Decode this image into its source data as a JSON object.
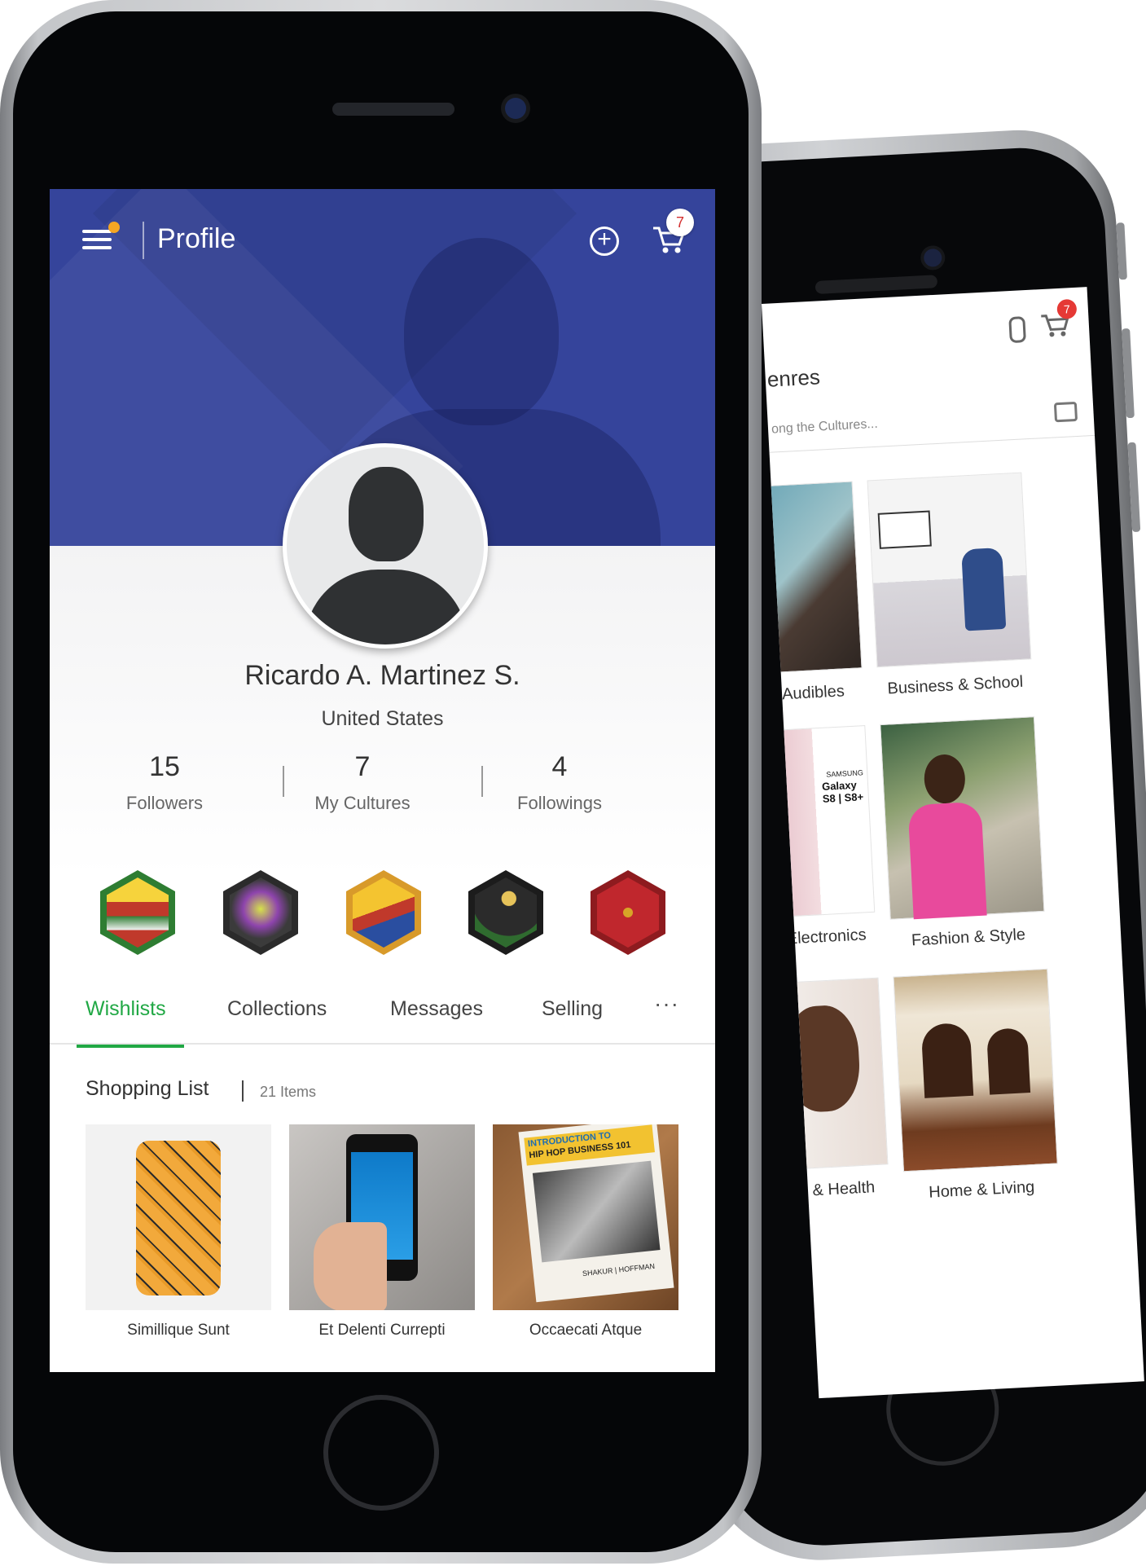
{
  "header": {
    "title": "Profile",
    "cart_count": "7"
  },
  "profile": {
    "name": "Ricardo A. Martinez S.",
    "country": "United States"
  },
  "stats": [
    {
      "value": "15",
      "label": "Followers"
    },
    {
      "value": "7",
      "label": "My Cultures"
    },
    {
      "value": "4",
      "label": "Followings"
    }
  ],
  "culture_badges": [
    {
      "icon": "mexican-sombrero-icon",
      "color": "#c0392b"
    },
    {
      "icon": "graffiti-music-icon",
      "color": "#3b3b3b"
    },
    {
      "icon": "maracas-icon",
      "color": "#f4c430"
    },
    {
      "icon": "crescent-mosque-icon",
      "color": "#2b2b2b"
    },
    {
      "icon": "chinese-calligraphy-icon",
      "color": "#c0272d"
    }
  ],
  "tabs": [
    {
      "label": "Wishlists",
      "active": true
    },
    {
      "label": "Collections"
    },
    {
      "label": "Messages"
    },
    {
      "label": "Selling"
    }
  ],
  "more_label": "···",
  "shopping_list": {
    "title": "Shopping List",
    "count": "21 Items",
    "items": [
      {
        "name": "Simillique Sunt"
      },
      {
        "name": "Et Delenti Currepti"
      },
      {
        "name": "Occaecati Atque"
      }
    ]
  },
  "back_screen": {
    "cart_count": "7",
    "title_fragment": "enres",
    "search_placeholder": "ong the Cultures...",
    "categories": [
      {
        "label": "/ Audibles"
      },
      {
        "label": "Business & School"
      },
      {
        "label": "Electronics"
      },
      {
        "label": "Fashion & Style"
      },
      {
        "label": "y & Health"
      },
      {
        "label": "Home & Living"
      }
    ],
    "phone_ad_text": "Galaxy S8 | S8+",
    "phone_ad_brand": "SAMSUNG"
  },
  "book_cover": {
    "line1": "INTRODUCTION TO",
    "line2": "HIP HOP BUSINESS 101",
    "authors": "SHAKUR | HOFFMAN"
  },
  "colors": {
    "hero": "#35449b",
    "accent_green": "#21a845",
    "badge_red": "#e53935"
  }
}
